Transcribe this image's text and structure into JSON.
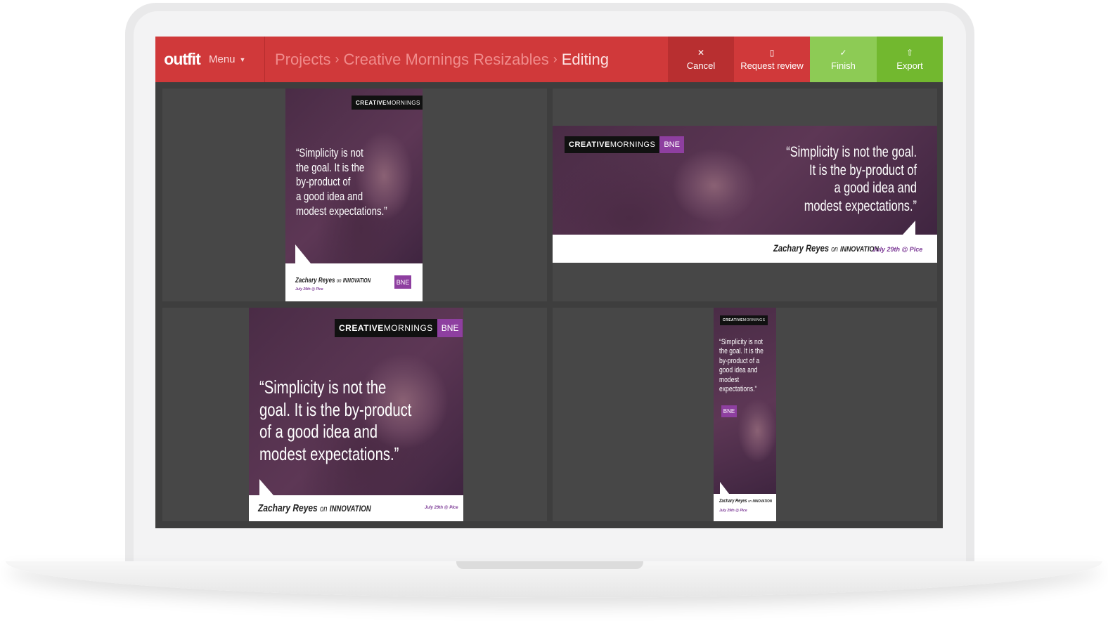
{
  "toolbar": {
    "logo": "outfit",
    "menu_label": "Menu",
    "breadcrumbs": [
      "Projects",
      "Creative Mornings Resizables",
      "Editing"
    ],
    "separator": "›",
    "cancel_label": "Cancel",
    "review_label": "Request review",
    "finish_label": "Finish",
    "export_label": "Export"
  },
  "icons": {
    "cancel": "✕",
    "review": "▯",
    "finish": "✓",
    "export": "⇧",
    "caret": "▼"
  },
  "design": {
    "brand_bold": "CREATIVE",
    "brand_light": "MORNINGS",
    "city": "BNE",
    "quote_line1": "“Simplicity is not",
    "quote_line2": "the goal. It is the",
    "quote_line3": "by-product of",
    "quote_line4": "a good idea and",
    "quote_line5": "modest expectations.”",
    "wide_line1": "“Simplicity is not the goal.",
    "wide_line2": "It is the by-product of",
    "wide_line3": "a good idea and",
    "wide_line4": "modest expectations.”",
    "square_line1": "“Simplicity is not the",
    "square_line2": "goal. It is the by-product",
    "square_line3": "of a good idea and",
    "square_line4": "modest expectations.”",
    "tall_line1": "“Simplicity is not",
    "tall_line2": "the goal. It is the",
    "tall_line3": "by-product of a",
    "tall_line4": "good idea and",
    "tall_line5": "modest",
    "tall_line6": "expectations.”",
    "speaker_name": "Zachary Reyes",
    "speaker_on": "on",
    "speaker_topic": "INNOVATION",
    "date": "July 29th @ Plce"
  },
  "colors": {
    "toolbar_red": "#d0393a",
    "finish_green": "#8dcb55",
    "export_green": "#72b82f",
    "city_purple": "#8e3fa0"
  }
}
